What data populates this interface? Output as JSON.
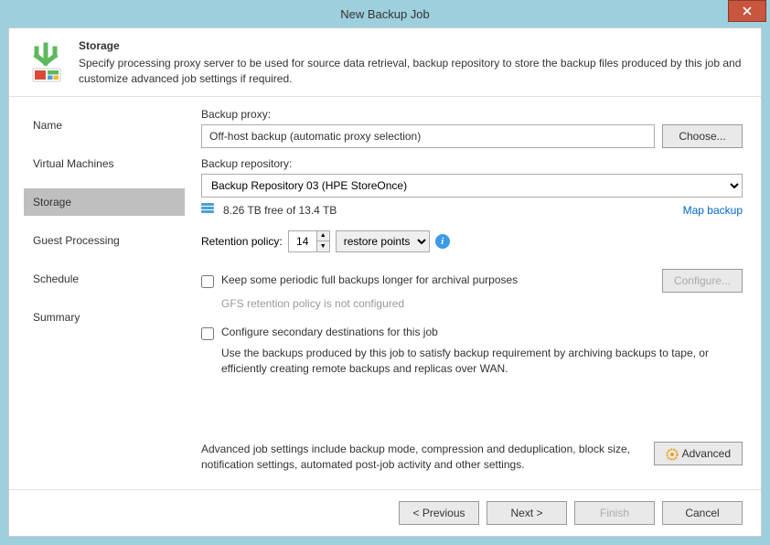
{
  "window": {
    "title": "New Backup Job"
  },
  "header": {
    "title": "Storage",
    "description": "Specify processing proxy server to be used for source data retrieval, backup repository to store the backup files produced by this job and customize advanced job settings if required."
  },
  "sidebar": {
    "items": [
      {
        "label": "Name",
        "active": false
      },
      {
        "label": "Virtual Machines",
        "active": false
      },
      {
        "label": "Storage",
        "active": true
      },
      {
        "label": "Guest Processing",
        "active": false
      },
      {
        "label": "Schedule",
        "active": false
      },
      {
        "label": "Summary",
        "active": false
      }
    ]
  },
  "main": {
    "proxy_label": "Backup proxy:",
    "proxy_value": "Off-host backup (automatic proxy selection)",
    "choose_btn": "Choose...",
    "repo_label": "Backup repository:",
    "repo_value": "Backup Repository 03 (HPE StoreOnce)",
    "free_space": "8.26 TB free of 13.4 TB",
    "map_backup": "Map backup",
    "retention_label": "Retention policy:",
    "retention_value": "14",
    "retention_unit": "restore points",
    "keep_full_label": "Keep some periodic full backups longer for archival purposes",
    "configure_btn": "Configure...",
    "gfs_note": "GFS retention policy is not configured",
    "secondary_label": "Configure secondary destinations for this job",
    "secondary_desc": "Use the backups produced by this job to satisfy backup requirement by archiving backups to tape, or efficiently creating remote backups and replicas over WAN.",
    "advanced_desc": "Advanced job settings include backup mode, compression and deduplication, block size, notification settings, automated post-job activity and other settings.",
    "advanced_btn": "Advanced"
  },
  "footer": {
    "previous": "< Previous",
    "next": "Next >",
    "finish": "Finish",
    "cancel": "Cancel"
  }
}
